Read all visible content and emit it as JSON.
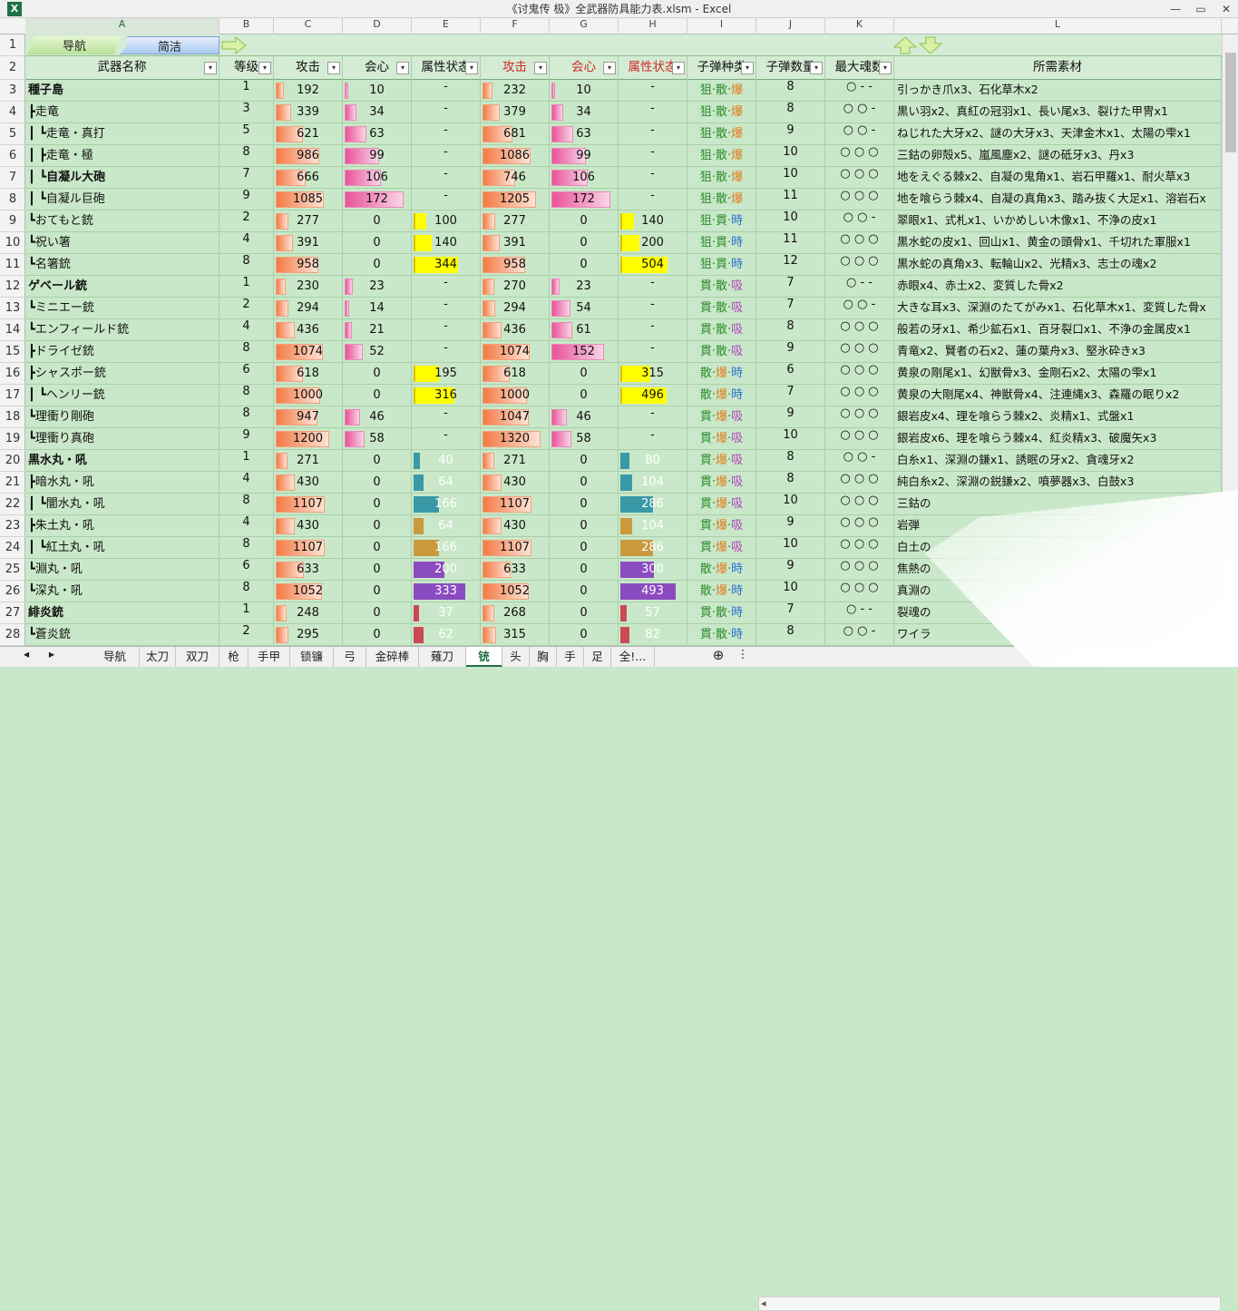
{
  "window": {
    "title": "《讨鬼传 极》全武器防具能力表.xlsm - Excel",
    "app_icon": "X",
    "min": "—",
    "max": "▭",
    "close": "✕"
  },
  "column_letters": [
    "A",
    "B",
    "C",
    "D",
    "E",
    "F",
    "G",
    "H",
    "I",
    "J",
    "K",
    "L"
  ],
  "nav": {
    "guide": "导航",
    "simple": "简洁"
  },
  "headers": [
    "武器名称",
    "等级",
    "攻击",
    "会心",
    "属性状态",
    "攻击",
    "会心",
    "属性状态",
    "子弹种类",
    "子弹数量",
    "最大魂数",
    "所需素材"
  ],
  "header_display": [
    "武器名称",
    "等级",
    "攻击",
    "会心",
    "属性状态",
    "攻击",
    "会心",
    "属性状态",
    "子弹种类",
    "子弹数量",
    "最大魂数",
    "所需素材"
  ],
  "rows": [
    {
      "n": "3",
      "name": "種子島",
      "bold": true,
      "lv": "1",
      "atk": "192",
      "crit": "10",
      "attr": "-",
      "atk2": "232",
      "crit2": "10",
      "attr2": "-",
      "b": [
        "狙",
        "散",
        "爆"
      ],
      "cnt": "8",
      "soul": "○ - -",
      "mat": "引っかき爪x3、石化草木x2"
    },
    {
      "n": "4",
      "name": "┣走竜",
      "bold": false,
      "lv": "3",
      "atk": "339",
      "crit": "34",
      "attr": "-",
      "atk2": "379",
      "crit2": "34",
      "attr2": "-",
      "b": [
        "狙",
        "散",
        "爆"
      ],
      "cnt": "8",
      "soul": "○ ○ -",
      "mat": "黒い羽x2、真紅の冠羽x1、長い尾x3、裂けた甲冑x1"
    },
    {
      "n": "5",
      "name": "┃ ┗走竜・真打",
      "bold": false,
      "lv": "5",
      "atk": "621",
      "crit": "63",
      "attr": "-",
      "atk2": "681",
      "crit2": "63",
      "attr2": "-",
      "b": [
        "狙",
        "散",
        "爆"
      ],
      "cnt": "9",
      "soul": "○ ○ -",
      "mat": "ねじれた大牙x2、謎の大牙x3、天津金木x1、太陽の雫x1"
    },
    {
      "n": "6",
      "name": "┃   ┣走竜・極",
      "bold": false,
      "lv": "8",
      "atk": "986",
      "crit": "99",
      "attr": "-",
      "atk2": "1086",
      "crit2": "99",
      "attr2": "-",
      "b": [
        "狙",
        "散",
        "爆"
      ],
      "cnt": "10",
      "soul": "○ ○ ○",
      "mat": "三鈷の卵殻x5、嵐風塵x2、謎の砥牙x3、丹x3"
    },
    {
      "n": "7",
      "name": "┃   ┗自凝ル大砲",
      "bold": true,
      "lv": "7",
      "atk": "666",
      "crit": "106",
      "attr": "-",
      "atk2": "746",
      "crit2": "106",
      "attr2": "-",
      "b": [
        "狙",
        "散",
        "爆"
      ],
      "cnt": "10",
      "soul": "○ ○ ○",
      "mat": "地をえぐる棘x2、自凝の鬼角x1、岩石甲羅x1、耐火草x3"
    },
    {
      "n": "8",
      "name": "┃     ┗自凝ル巨砲",
      "bold": false,
      "lv": "9",
      "atk": "1085",
      "crit": "172",
      "attr": "-",
      "atk2": "1205",
      "crit2": "172",
      "attr2": "-",
      "b": [
        "狙",
        "散",
        "爆"
      ],
      "cnt": "11",
      "soul": "○ ○ ○",
      "mat": "地を喰らう棘x4、自凝の真角x3、踏み抜く大足x1、溶岩石x"
    },
    {
      "n": "9",
      "name": "┗おてもと銃",
      "bold": false,
      "lv": "2",
      "atk": "277",
      "crit": "0",
      "attr": "100",
      "atk2": "277",
      "crit2": "0",
      "attr2": "140",
      "b": [
        "狙",
        "貫",
        "時"
      ],
      "cnt": "10",
      "soul": "○ ○ -",
      "mat": "翠眼x1、式札x1、いかめしい木像x1、不浄の皮x1"
    },
    {
      "n": "10",
      "name": "  ┗祝い箸",
      "bold": false,
      "lv": "4",
      "atk": "391",
      "crit": "0",
      "attr": "140",
      "atk2": "391",
      "crit2": "0",
      "attr2": "200",
      "b": [
        "狙",
        "貫",
        "時"
      ],
      "cnt": "11",
      "soul": "○ ○ ○",
      "mat": "黒水蛇の皮x1、回山x1、黄金の頭骨x1、千切れた軍服x1"
    },
    {
      "n": "11",
      "name": "    ┗名箸銃",
      "bold": false,
      "lv": "8",
      "atk": "958",
      "crit": "0",
      "attr": "344",
      "atk2": "958",
      "crit2": "0",
      "attr2": "504",
      "b": [
        "狙",
        "貫",
        "時"
      ],
      "cnt": "12",
      "soul": "○ ○ ○",
      "mat": "黒水蛇の真角x3、転輪山x2、光精x3、志士の魂x2"
    },
    {
      "n": "12",
      "name": "ゲベール銃",
      "bold": true,
      "lv": "1",
      "atk": "230",
      "crit": "23",
      "attr": "-",
      "atk2": "270",
      "crit2": "23",
      "attr2": "-",
      "b": [
        "貫",
        "散",
        "吸"
      ],
      "cnt": "7",
      "soul": "○ - -",
      "mat": "赤眼x4、赤土x2、変質した骨x2"
    },
    {
      "n": "13",
      "name": "┗ミニエー銃",
      "bold": false,
      "lv": "2",
      "atk": "294",
      "crit": "14",
      "attr": "-",
      "atk2": "294",
      "crit2": "54",
      "attr2": "-",
      "b": [
        "貫",
        "散",
        "吸"
      ],
      "cnt": "7",
      "soul": "○ ○ -",
      "mat": "大きな耳x3、深淵のたてがみx1、石化草木x1、変質した骨x"
    },
    {
      "n": "14",
      "name": "  ┗エンフィールド銃",
      "bold": false,
      "lv": "4",
      "atk": "436",
      "crit": "21",
      "attr": "-",
      "atk2": "436",
      "crit2": "61",
      "attr2": "-",
      "b": [
        "貫",
        "散",
        "吸"
      ],
      "cnt": "8",
      "soul": "○ ○ ○",
      "mat": "般若の牙x1、希少鉱石x1、百牙裂口x1、不浄の金属皮x1"
    },
    {
      "n": "15",
      "name": "    ┣ドライゼ銃",
      "bold": false,
      "lv": "8",
      "atk": "1074",
      "crit": "52",
      "attr": "-",
      "atk2": "1074",
      "crit2": "152",
      "attr2": "-",
      "b": [
        "貫",
        "散",
        "吸"
      ],
      "cnt": "9",
      "soul": "○ ○ ○",
      "mat": "青竜x2、賢者の石x2、蓮の葉舟x3、堅氷砕きx3"
    },
    {
      "n": "16",
      "name": "    ┣シャスポー銃",
      "bold": false,
      "lv": "6",
      "atk": "618",
      "crit": "0",
      "attr": "195",
      "atk2": "618",
      "crit2": "0",
      "attr2": "315",
      "b": [
        "散",
        "爆",
        "時"
      ],
      "cnt": "6",
      "soul": "○ ○ ○",
      "mat": "黄泉の剛尾x1、幻獣骨x3、金剛石x2、太陽の雫x1"
    },
    {
      "n": "17",
      "name": "    ┃ ┗ヘンリー銃",
      "bold": false,
      "lv": "8",
      "atk": "1000",
      "crit": "0",
      "attr": "316",
      "atk2": "1000",
      "crit2": "0",
      "attr2": "496",
      "b": [
        "散",
        "爆",
        "時"
      ],
      "cnt": "7",
      "soul": "○ ○ ○",
      "mat": "黄泉の大剛尾x4、神獣骨x4、注連縄x3、森羅の眠りx2"
    },
    {
      "n": "18",
      "name": "    ┗理衝り剛砲",
      "bold": false,
      "lv": "8",
      "atk": "947",
      "crit": "46",
      "attr": "-",
      "atk2": "1047",
      "crit2": "46",
      "attr2": "-",
      "b": [
        "貫",
        "爆",
        "吸"
      ],
      "cnt": "9",
      "soul": "○ ○ ○",
      "mat": "銀岩皮x4、理を喰らう棘x2、炎精x1、式盤x1"
    },
    {
      "n": "19",
      "name": "      ┗理衝り真砲",
      "bold": false,
      "lv": "9",
      "atk": "1200",
      "crit": "58",
      "attr": "-",
      "atk2": "1320",
      "crit2": "58",
      "attr2": "-",
      "b": [
        "貫",
        "爆",
        "吸"
      ],
      "cnt": "10",
      "soul": "○ ○ ○",
      "mat": "銀岩皮x6、理を喰らう棘x4、紅炎精x3、破魔矢x3"
    },
    {
      "n": "20",
      "name": "黒水丸・吼",
      "bold": true,
      "lv": "1",
      "atk": "271",
      "crit": "0",
      "attr": "40",
      "atk2": "271",
      "crit2": "0",
      "attr2": "80",
      "b": [
        "貫",
        "爆",
        "吸"
      ],
      "cnt": "8",
      "soul": "○ ○ -",
      "mat": "白糸x1、深淵の鎌x1、誘眠の牙x2、貪魂牙x2"
    },
    {
      "n": "21",
      "name": "┣暗水丸・吼",
      "bold": false,
      "lv": "4",
      "atk": "430",
      "crit": "0",
      "attr": "64",
      "atk2": "430",
      "crit2": "0",
      "attr2": "104",
      "b": [
        "貫",
        "爆",
        "吸"
      ],
      "cnt": "8",
      "soul": "○ ○ ○",
      "mat": "純白糸x2、深淵の鋭鎌x2、噴夢器x3、白鼓x3"
    },
    {
      "n": "22",
      "name": "┃ ┗闇水丸・吼",
      "bold": false,
      "lv": "8",
      "atk": "1107",
      "crit": "0",
      "attr": "166",
      "atk2": "1107",
      "crit2": "0",
      "attr2": "286",
      "b": [
        "貫",
        "爆",
        "吸"
      ],
      "cnt": "10",
      "soul": "○ ○ ○",
      "mat": "三鈷の"
    },
    {
      "n": "23",
      "name": "┣朱土丸・吼",
      "bold": false,
      "lv": "4",
      "atk": "430",
      "crit": "0",
      "attr": "64",
      "atk2": "430",
      "crit2": "0",
      "attr2": "104",
      "b": [
        "貫",
        "爆",
        "吸"
      ],
      "cnt": "9",
      "soul": "○ ○ ○",
      "mat": "岩弾"
    },
    {
      "n": "24",
      "name": "┃ ┗紅土丸・吼",
      "bold": false,
      "lv": "8",
      "atk": "1107",
      "crit": "0",
      "attr": "166",
      "atk2": "1107",
      "crit2": "0",
      "attr2": "286",
      "b": [
        "貫",
        "爆",
        "吸"
      ],
      "cnt": "10",
      "soul": "○ ○ ○",
      "mat": "白土の"
    },
    {
      "n": "25",
      "name": "┗淵丸・吼",
      "bold": false,
      "lv": "6",
      "atk": "633",
      "crit": "0",
      "attr": "200",
      "atk2": "633",
      "crit2": "0",
      "attr2": "300",
      "b": [
        "散",
        "爆",
        "時"
      ],
      "cnt": "9",
      "soul": "○ ○ ○",
      "mat": "焦熱の"
    },
    {
      "n": "26",
      "name": "  ┗深丸・吼",
      "bold": false,
      "lv": "8",
      "atk": "1052",
      "crit": "0",
      "attr": "333",
      "atk2": "1052",
      "crit2": "0",
      "attr2": "493",
      "b": [
        "散",
        "爆",
        "時"
      ],
      "cnt": "10",
      "soul": "○ ○ ○",
      "mat": "真淵の"
    },
    {
      "n": "27",
      "name": "緋炎銃",
      "bold": true,
      "lv": "1",
      "atk": "248",
      "crit": "0",
      "attr": "37",
      "atk2": "268",
      "crit2": "0",
      "attr2": "57",
      "b": [
        "貫",
        "散",
        "時"
      ],
      "cnt": "7",
      "soul": "○ - -",
      "mat": "裂魂の"
    },
    {
      "n": "28",
      "name": "┗蒼炎銃",
      "bold": false,
      "lv": "2",
      "atk": "295",
      "crit": "0",
      "attr": "62",
      "atk2": "315",
      "crit2": "0",
      "attr2": "82",
      "b": [
        "貫",
        "散",
        "時"
      ],
      "cnt": "8",
      "soul": "○ ○ -",
      "mat": "ワイラ"
    }
  ],
  "attr_colors": {
    "yellow": "#ffff00",
    "teal": "#3999a6",
    "ochre": "#c99a3e",
    "purple": "#8b4bc0",
    "red": "#c94a52"
  },
  "bullet_colors": {
    "狙": "#2c8a2c",
    "散": "#2c8a2c",
    "爆": "#e07b1c",
    "貫": "#2c8a2c",
    "時": "#2c6fd0",
    "吸": "#b040c0"
  },
  "tabs": [
    "导航",
    "太刀",
    "双刀",
    "枪",
    "手甲",
    "锁镰",
    "弓",
    "金碎棒",
    "薙刀",
    "铳",
    "头",
    "胸",
    "手",
    "足",
    "全!..."
  ],
  "active_tab": "铳",
  "tab_controls": {
    "prev": "◂",
    "next": "▸",
    "add": "⊕",
    "more": "⋮",
    "scroll_left": "◂"
  }
}
